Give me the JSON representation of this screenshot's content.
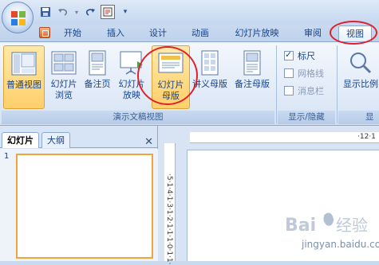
{
  "quick_access": {
    "save_icon": "save-icon",
    "undo_icon": "undo-icon",
    "redo_icon": "redo-icon",
    "special_icon": "special-icon",
    "customize_icon": "customize-qat-icon"
  },
  "tabs": [
    {
      "label": "开始"
    },
    {
      "label": "插入"
    },
    {
      "label": "设计"
    },
    {
      "label": "动画"
    },
    {
      "label": "幻灯片放映"
    },
    {
      "label": "审阅"
    },
    {
      "label": "视图"
    }
  ],
  "ribbon": {
    "groups": [
      {
        "label": "演示文稿视图",
        "buttons": [
          {
            "label_1": "普通视图",
            "label_2": "",
            "icon": "normal-view-icon"
          },
          {
            "label_1": "幻灯片",
            "label_2": "浏览",
            "icon": "slide-sorter-icon"
          },
          {
            "label_1": "备注页",
            "label_2": "",
            "icon": "notes-page-icon"
          },
          {
            "label_1": "幻灯片",
            "label_2": "放映",
            "icon": "slide-show-icon"
          },
          {
            "label_1": "幻灯片",
            "label_2": "母版",
            "icon": "slide-master-icon"
          },
          {
            "label_1": "讲义母版",
            "label_2": "",
            "icon": "handout-master-icon"
          },
          {
            "label_1": "备注母版",
            "label_2": "",
            "icon": "notes-master-icon"
          }
        ]
      },
      {
        "label": "显示/隐藏",
        "checkboxes": [
          {
            "label": "标尺",
            "checked": true
          },
          {
            "label": "网格线",
            "checked": false
          },
          {
            "label": "消息栏",
            "checked": false
          }
        ]
      },
      {
        "label": "显示",
        "buttons": [
          {
            "label_1": "显示比例",
            "icon": "zoom-icon"
          }
        ]
      }
    ]
  },
  "left_pane": {
    "tabs": [
      {
        "label": "幻灯片"
      },
      {
        "label": "大纲"
      }
    ],
    "close": "✕",
    "slides": [
      {
        "number": "1"
      }
    ]
  },
  "rulers": {
    "horizontal_label": "·12·1",
    "vertical_label": "·5·1·4·1·3·1·2·1·1·1·0·1·1·"
  },
  "watermark": {
    "brand": "Bai 经验",
    "url": "jingyan.baidu.com"
  },
  "colors": {
    "accent": "#15428b",
    "selected": "#ffcf6b",
    "annotation": "#e0202a"
  }
}
